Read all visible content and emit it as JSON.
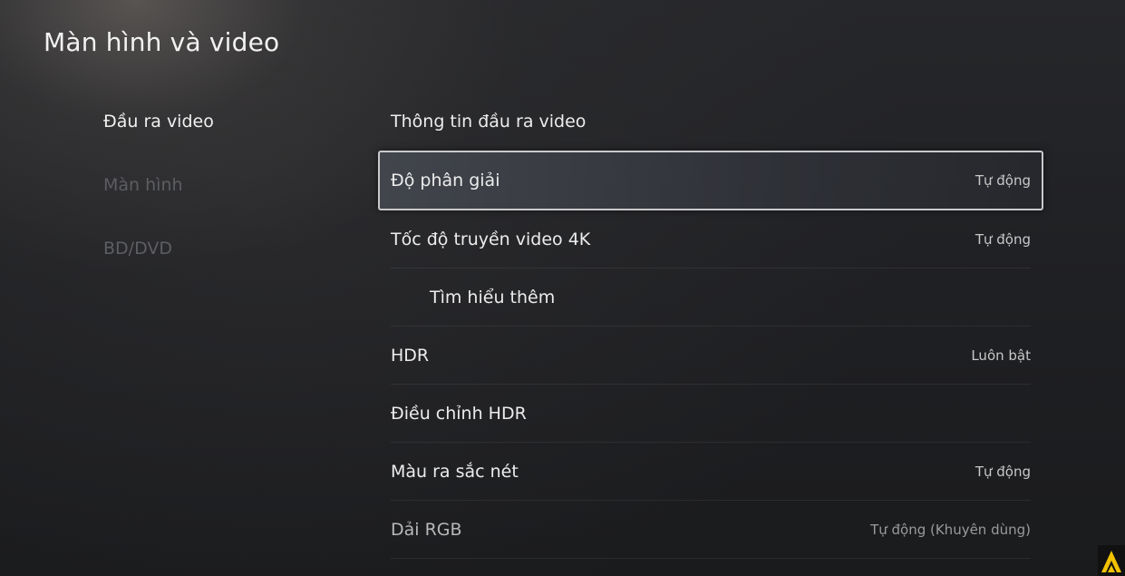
{
  "header": {
    "title": "Màn hình và video"
  },
  "sidebar": {
    "items": [
      {
        "label": "Đầu ra video"
      },
      {
        "label": "Màn hình"
      },
      {
        "label": "BD/DVD"
      }
    ]
  },
  "settings": {
    "rows": [
      {
        "label": "Thông tin đầu ra video",
        "value": ""
      },
      {
        "label": "Độ phân giải",
        "value": "Tự động"
      },
      {
        "label": "Tốc độ truyền video 4K",
        "value": "Tự động"
      },
      {
        "label": "Tìm hiểu thêm",
        "value": ""
      },
      {
        "label": "HDR",
        "value": "Luôn bật"
      },
      {
        "label": "Điều chỉnh HDR",
        "value": ""
      },
      {
        "label": "Màu ra sắc nét",
        "value": "Tự động"
      },
      {
        "label": "Dải RGB",
        "value": "Tự động (Khuyên dùng)"
      }
    ]
  },
  "colors": {
    "logo_yellow": "#f2c200",
    "selection_border": "#c9c9cc"
  }
}
